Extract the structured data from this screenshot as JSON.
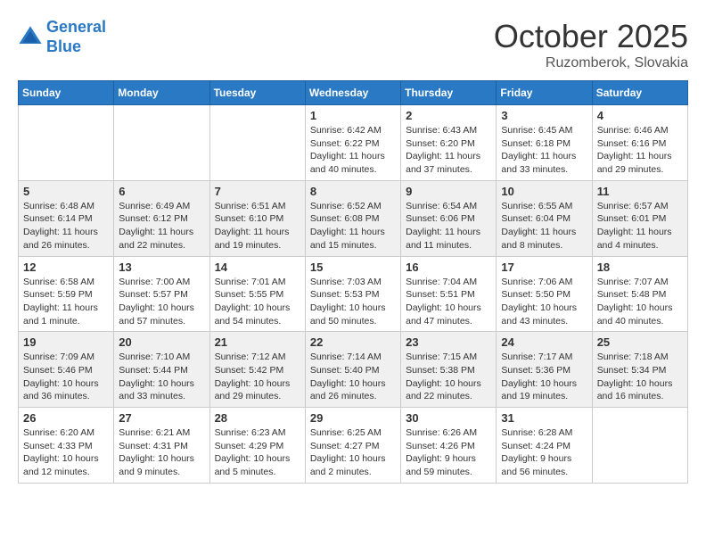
{
  "header": {
    "logo_line1": "General",
    "logo_line2": "Blue",
    "month": "October 2025",
    "location": "Ruzomberok, Slovakia"
  },
  "days_of_week": [
    "Sunday",
    "Monday",
    "Tuesday",
    "Wednesday",
    "Thursday",
    "Friday",
    "Saturday"
  ],
  "weeks": [
    [
      {
        "day": "",
        "info": ""
      },
      {
        "day": "",
        "info": ""
      },
      {
        "day": "",
        "info": ""
      },
      {
        "day": "1",
        "info": "Sunrise: 6:42 AM\nSunset: 6:22 PM\nDaylight: 11 hours\nand 40 minutes."
      },
      {
        "day": "2",
        "info": "Sunrise: 6:43 AM\nSunset: 6:20 PM\nDaylight: 11 hours\nand 37 minutes."
      },
      {
        "day": "3",
        "info": "Sunrise: 6:45 AM\nSunset: 6:18 PM\nDaylight: 11 hours\nand 33 minutes."
      },
      {
        "day": "4",
        "info": "Sunrise: 6:46 AM\nSunset: 6:16 PM\nDaylight: 11 hours\nand 29 minutes."
      }
    ],
    [
      {
        "day": "5",
        "info": "Sunrise: 6:48 AM\nSunset: 6:14 PM\nDaylight: 11 hours\nand 26 minutes."
      },
      {
        "day": "6",
        "info": "Sunrise: 6:49 AM\nSunset: 6:12 PM\nDaylight: 11 hours\nand 22 minutes."
      },
      {
        "day": "7",
        "info": "Sunrise: 6:51 AM\nSunset: 6:10 PM\nDaylight: 11 hours\nand 19 minutes."
      },
      {
        "day": "8",
        "info": "Sunrise: 6:52 AM\nSunset: 6:08 PM\nDaylight: 11 hours\nand 15 minutes."
      },
      {
        "day": "9",
        "info": "Sunrise: 6:54 AM\nSunset: 6:06 PM\nDaylight: 11 hours\nand 11 minutes."
      },
      {
        "day": "10",
        "info": "Sunrise: 6:55 AM\nSunset: 6:04 PM\nDaylight: 11 hours\nand 8 minutes."
      },
      {
        "day": "11",
        "info": "Sunrise: 6:57 AM\nSunset: 6:01 PM\nDaylight: 11 hours\nand 4 minutes."
      }
    ],
    [
      {
        "day": "12",
        "info": "Sunrise: 6:58 AM\nSunset: 5:59 PM\nDaylight: 11 hours\nand 1 minute."
      },
      {
        "day": "13",
        "info": "Sunrise: 7:00 AM\nSunset: 5:57 PM\nDaylight: 10 hours\nand 57 minutes."
      },
      {
        "day": "14",
        "info": "Sunrise: 7:01 AM\nSunset: 5:55 PM\nDaylight: 10 hours\nand 54 minutes."
      },
      {
        "day": "15",
        "info": "Sunrise: 7:03 AM\nSunset: 5:53 PM\nDaylight: 10 hours\nand 50 minutes."
      },
      {
        "day": "16",
        "info": "Sunrise: 7:04 AM\nSunset: 5:51 PM\nDaylight: 10 hours\nand 47 minutes."
      },
      {
        "day": "17",
        "info": "Sunrise: 7:06 AM\nSunset: 5:50 PM\nDaylight: 10 hours\nand 43 minutes."
      },
      {
        "day": "18",
        "info": "Sunrise: 7:07 AM\nSunset: 5:48 PM\nDaylight: 10 hours\nand 40 minutes."
      }
    ],
    [
      {
        "day": "19",
        "info": "Sunrise: 7:09 AM\nSunset: 5:46 PM\nDaylight: 10 hours\nand 36 minutes."
      },
      {
        "day": "20",
        "info": "Sunrise: 7:10 AM\nSunset: 5:44 PM\nDaylight: 10 hours\nand 33 minutes."
      },
      {
        "day": "21",
        "info": "Sunrise: 7:12 AM\nSunset: 5:42 PM\nDaylight: 10 hours\nand 29 minutes."
      },
      {
        "day": "22",
        "info": "Sunrise: 7:14 AM\nSunset: 5:40 PM\nDaylight: 10 hours\nand 26 minutes."
      },
      {
        "day": "23",
        "info": "Sunrise: 7:15 AM\nSunset: 5:38 PM\nDaylight: 10 hours\nand 22 minutes."
      },
      {
        "day": "24",
        "info": "Sunrise: 7:17 AM\nSunset: 5:36 PM\nDaylight: 10 hours\nand 19 minutes."
      },
      {
        "day": "25",
        "info": "Sunrise: 7:18 AM\nSunset: 5:34 PM\nDaylight: 10 hours\nand 16 minutes."
      }
    ],
    [
      {
        "day": "26",
        "info": "Sunrise: 6:20 AM\nSunset: 4:33 PM\nDaylight: 10 hours\nand 12 minutes."
      },
      {
        "day": "27",
        "info": "Sunrise: 6:21 AM\nSunset: 4:31 PM\nDaylight: 10 hours\nand 9 minutes."
      },
      {
        "day": "28",
        "info": "Sunrise: 6:23 AM\nSunset: 4:29 PM\nDaylight: 10 hours\nand 5 minutes."
      },
      {
        "day": "29",
        "info": "Sunrise: 6:25 AM\nSunset: 4:27 PM\nDaylight: 10 hours\nand 2 minutes."
      },
      {
        "day": "30",
        "info": "Sunrise: 6:26 AM\nSunset: 4:26 PM\nDaylight: 9 hours\nand 59 minutes."
      },
      {
        "day": "31",
        "info": "Sunrise: 6:28 AM\nSunset: 4:24 PM\nDaylight: 9 hours\nand 56 minutes."
      },
      {
        "day": "",
        "info": ""
      }
    ]
  ]
}
